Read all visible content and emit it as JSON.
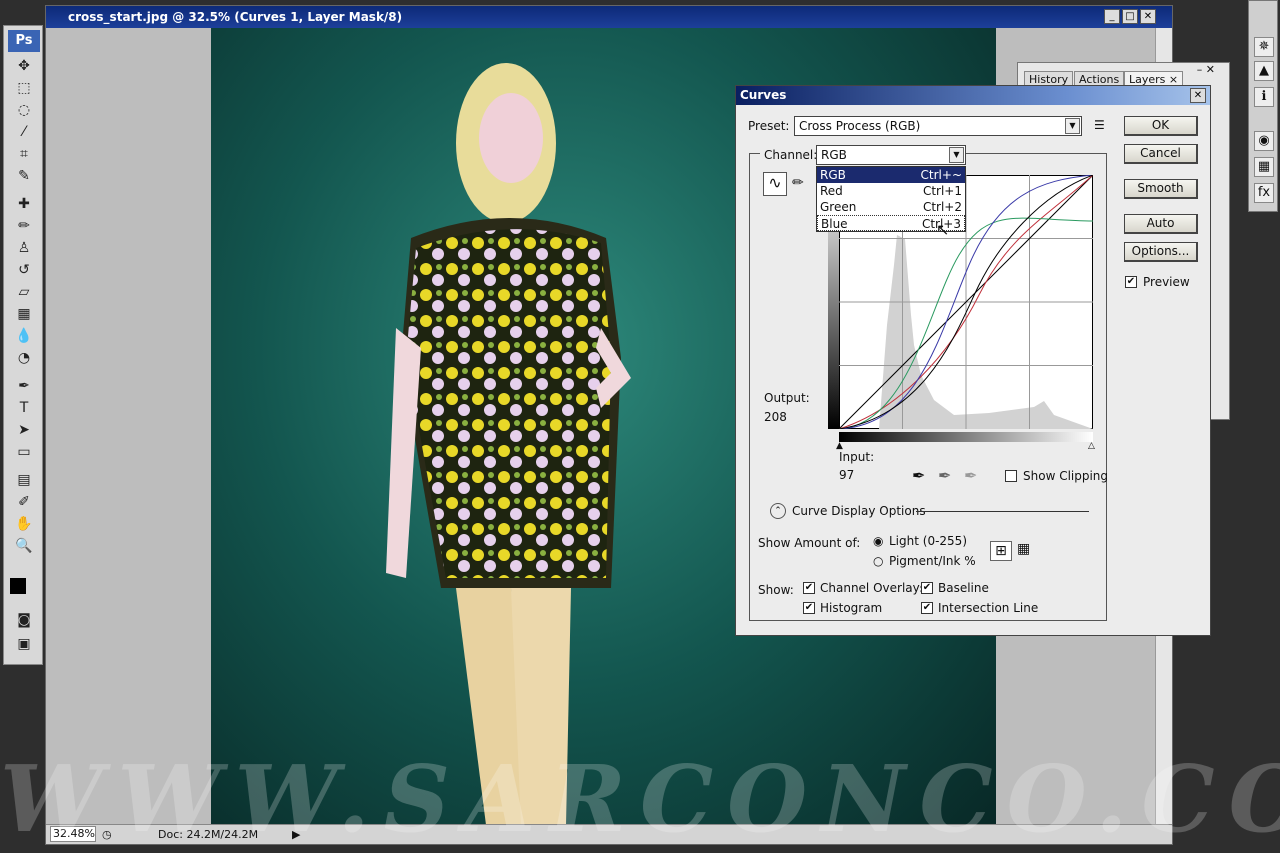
{
  "app": {
    "logo": "Ps"
  },
  "document": {
    "title": "cross_start.jpg @ 32.5% (Curves 1, Layer Mask/8)",
    "zoom": "32.48%",
    "doc_size": "Doc: 24.2M/24.2M",
    "watermark": "WWW.SARCONCO.CO"
  },
  "panel": {
    "tabs": [
      "History",
      "Actions",
      "Layers ×"
    ]
  },
  "curves": {
    "title": "Curves",
    "preset_label": "Preset:",
    "preset_value": "Cross Process (RGB)",
    "channel_label": "Channel:",
    "channel_value": "RGB",
    "channel_options": [
      {
        "label": "RGB",
        "shortcut": "Ctrl+~"
      },
      {
        "label": "Red",
        "shortcut": "Ctrl+1"
      },
      {
        "label": "Green",
        "shortcut": "Ctrl+2"
      },
      {
        "label": "Blue",
        "shortcut": "Ctrl+3"
      }
    ],
    "buttons": {
      "ok": "OK",
      "cancel": "Cancel",
      "smooth": "Smooth",
      "auto": "Auto",
      "options": "Options..."
    },
    "preview_label": "Preview",
    "preview_checked": true,
    "output_label": "Output:",
    "output_value": "208",
    "input_label": "Input:",
    "input_value": "97",
    "show_clipping": "Show Clipping",
    "display_options": "Curve Display Options",
    "show_amount_label": "Show Amount of:",
    "light": "Light  (0-255)",
    "pigment": "Pigment/Ink %",
    "show_label": "Show:",
    "channel_overlays": "Channel Overlays",
    "baseline": "Baseline",
    "histogram": "Histogram",
    "intersection_line": "Intersection Line",
    "curve_colors": {
      "red": "#c0303a",
      "green": "#2a9a60",
      "blue": "#3a3aa8"
    }
  }
}
